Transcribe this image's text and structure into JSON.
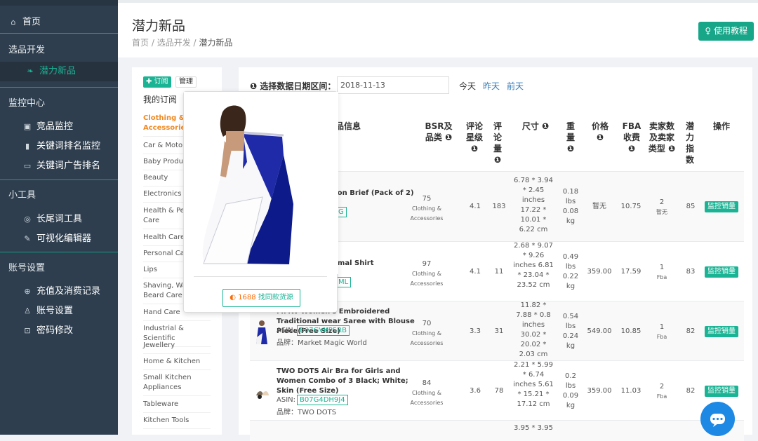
{
  "sidebar": {
    "home": "首页",
    "sec_dev": "选品开发",
    "dev_item": "潜力新品",
    "sec_monitor": "监控中心",
    "monitor_items": [
      "竞品监控",
      "关键词排名监控",
      "关键词广告排名"
    ],
    "sec_tools": "小工具",
    "tools_items": [
      "长尾词工具",
      "可视化编辑器"
    ],
    "sec_account": "账号设置",
    "account_items": [
      "充值及消费记录",
      "账号设置",
      "密码修改"
    ]
  },
  "header": {
    "title": "潜力新品",
    "breadcrumb": [
      "首页",
      "选品开发",
      "潜力新品"
    ],
    "tutorial_btn": "使用教程"
  },
  "categories": {
    "subscribe_btn": "订阅",
    "manage_btn": "管理",
    "title": "我的订阅",
    "items": [
      "Clothing & Accessories",
      "Car & Motorbike",
      "Baby Products",
      "Beauty",
      "Electronics",
      "Health & Personal Care",
      "Health Care",
      "Personal Care",
      "Lips",
      "Shaving, Waxing & Beard Care",
      "Hand Care",
      "Industrial & Scientific",
      "Jewellery",
      "Home & Kitchen",
      "Small Kitchen Appliances",
      "Tableware",
      "Kitchen Tools"
    ]
  },
  "filter": {
    "label": "选择数据日期区间：",
    "date": "2018-11-13",
    "today": "今天",
    "yesterday": "昨天",
    "day_before": "前天"
  },
  "table": {
    "headers": {
      "info": "品信息",
      "bsr": "BSR及品类",
      "rating": "评论星级",
      "reviews": "评论量",
      "size": "尺寸",
      "weight": "重量",
      "price": "价格",
      "fba": "FBA收费",
      "sellers": "卖家数及卖家类型",
      "potential": "潜力指数",
      "action": "操作"
    },
    "asin_label": "ASIN:",
    "brand_label": "品牌：",
    "monitor_btn": "监控销量",
    "rows": [
      {
        "name": "ton Brief (Pack of 2)",
        "asin": "G",
        "brand": "",
        "bsr": "75",
        "category": "Clothing & Accessories",
        "rating": "4.1",
        "reviews": "183",
        "size": "6.78 * 3.94 * 2.45 inches 17.22 * 10.01 * 6.22 cm",
        "weight": "0.18 lbs 0.08 kg",
        "price": "暂无",
        "fba": "10.75",
        "sellers": "2",
        "seller_type": "暂无",
        "potential": "85"
      },
      {
        "name": "rmal Shirt",
        "asin": "ML",
        "brand": "",
        "bsr": "97",
        "category": "Clothing & Accessories",
        "rating": "4.1",
        "reviews": "11",
        "size": "2.68 * 9.07 * 9.26 inches 6.81 * 23.04 * 23.52 cm",
        "weight": "0.49 lbs 0.22 kg",
        "price": "359.00",
        "fba": "17.59",
        "sellers": "1",
        "seller_type": "Fba",
        "potential": "83"
      },
      {
        "name": "MMW Women's Embroidered Traditional wear Saree with Blouse Piece(Free Size)",
        "asin": "B07GVKP5RB",
        "brand": "Market Magic World",
        "bsr": "70",
        "category": "Clothing & Accessories",
        "rating": "3.3",
        "reviews": "31",
        "size": "11.82 * 7.88 * 0.8 inches 30.02 * 20.02 * 2.03 cm",
        "weight": "0.54 lbs 0.24 kg",
        "price": "549.00",
        "fba": "10.85",
        "sellers": "1",
        "seller_type": "Fba",
        "potential": "82"
      },
      {
        "name": "TWO DOTS Air Bra for Girls and Women Combo of 3 Black; White; Skin (Free Size)",
        "asin": "B07G4DH9J4",
        "brand": "TWO DOTS",
        "bsr": "84",
        "category": "Clothing & Accessories",
        "rating": "3.6",
        "reviews": "78",
        "size": "2.21 * 5.99 * 6.74 inches 5.61 * 15.21 * 17.12 cm",
        "weight": "0.2 lbs 0.09 kg",
        "price": "359.00",
        "fba": "11.03",
        "sellers": "2",
        "seller_type": "Fba",
        "potential": "82"
      },
      {
        "size": "3.95 * 3.95"
      }
    ]
  },
  "popup": {
    "button": "找同款货源",
    "logo_text": "1688"
  }
}
